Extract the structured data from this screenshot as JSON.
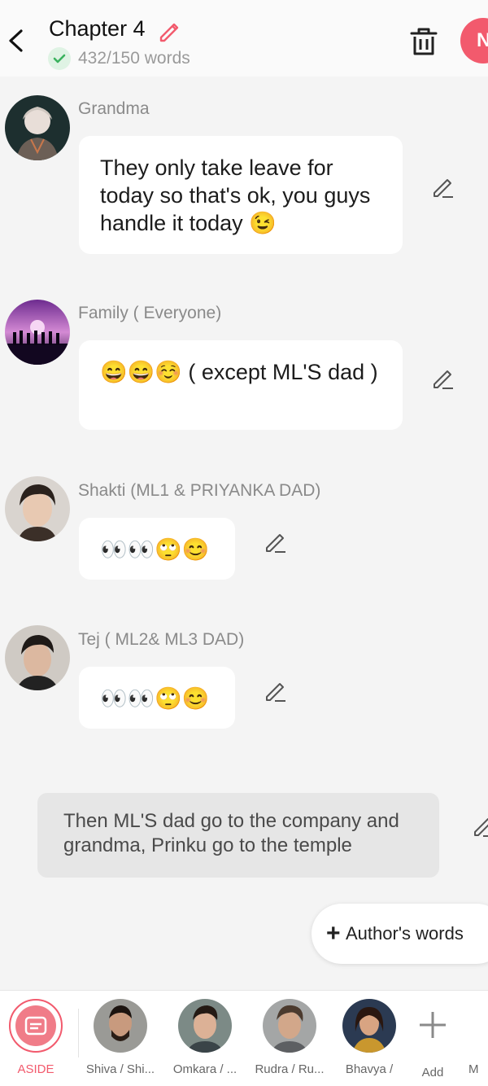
{
  "header": {
    "title": "Chapter 4",
    "word_count": "432/150 words",
    "next_button_letter": "N"
  },
  "messages": [
    {
      "speaker": "Grandma",
      "text": "They only take leave for today so that's ok, you guys handle it today 😉"
    },
    {
      "speaker": "Family ( Everyone)",
      "text": "😄😄☺️ ( except ML'S dad )"
    },
    {
      "speaker": "Shakti (ML1 & PRIYANKA DAD)",
      "text": "👀👀🙄😊"
    },
    {
      "speaker": "Tej ( ML2& ML3 DAD)",
      "text": "👀👀🙄😊"
    }
  ],
  "aside": {
    "text": "Then ML'S dad go to the company and grandma, Prinku go to the temple"
  },
  "authors_words": {
    "label": "Author's words"
  },
  "bottom_bar": {
    "aside_label": "ASIDE",
    "characters": [
      "Shiva / Shi...",
      "Omkara / ...",
      "Rudra / Ru...",
      "Bhavya /"
    ],
    "add_label": "Add",
    "more_label": "M"
  },
  "colors": {
    "accent": "#f25a6d",
    "bubble": "#ffffff",
    "background": "#f4f4f4",
    "aside_bubble": "#e6e6e6"
  }
}
